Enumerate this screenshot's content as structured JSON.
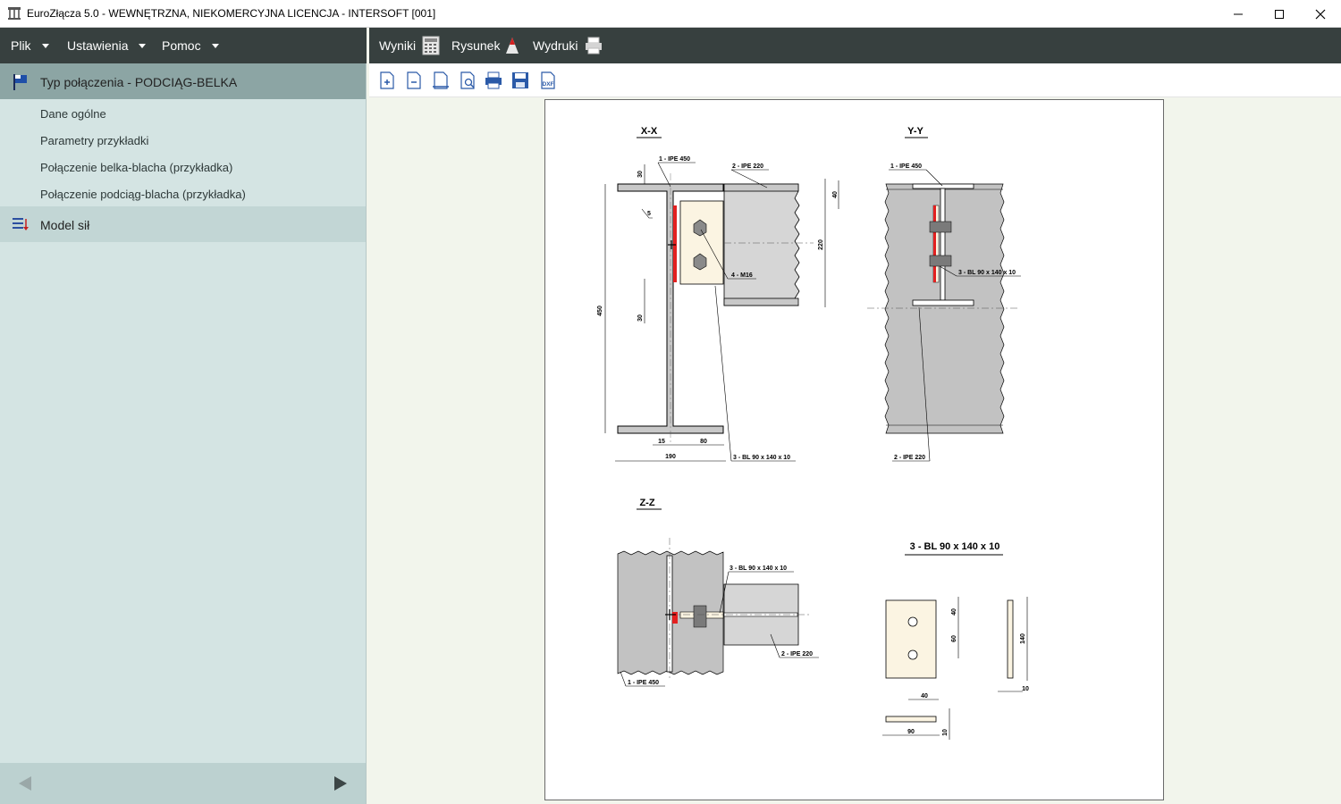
{
  "window": {
    "title": "EuroZłącza 5.0 - WEWNĘTRZNA, NIEKOMERCYJNA LICENCJA - INTERSOFT [001]"
  },
  "left_menu": [
    {
      "label": "Plik"
    },
    {
      "label": "Ustawienia"
    },
    {
      "label": "Pomoc"
    }
  ],
  "sidebar": {
    "group1": {
      "label": "Typ połączenia - PODCIĄG-BELKA"
    },
    "items": [
      {
        "label": "Dane ogólne"
      },
      {
        "label": "Parametry przykładki"
      },
      {
        "label": "Połączenie belka-blacha (przykładka)"
      },
      {
        "label": "Połączenie podciąg-blacha (przykładka)"
      }
    ],
    "group2": {
      "label": "Model sił"
    }
  },
  "top_menu": [
    {
      "label": "Wyniki",
      "icon": "calculator-icon"
    },
    {
      "label": "Rysunek",
      "icon": "drawing-icon"
    },
    {
      "label": "Wydruki",
      "icon": "printer-icon"
    }
  ],
  "toolbar": {
    "buttons": [
      "zoom-in-page",
      "zoom-out-page",
      "fit-width",
      "print-preview",
      "print",
      "save",
      "export-dxf"
    ],
    "dxf_label": "DXF"
  },
  "drawing": {
    "sections": {
      "xx": "X-X",
      "yy": "Y-Y",
      "zz": "Z-Z",
      "plate": "3 - BL 90 x 140 x 10"
    },
    "labels": {
      "ipe450": "1 - IPE 450",
      "ipe220": "2 - IPE 220",
      "plate": "3 - BL 90 x 140 x 10",
      "bolts": "4 - M16"
    },
    "dims": {
      "d30a": "30",
      "d5": "5",
      "d30b": "30",
      "d450": "450",
      "d40": "40",
      "d220": "220",
      "d15": "15",
      "d80": "80",
      "d190": "190",
      "p40a": "40",
      "p60": "60",
      "p140": "140",
      "p10a": "10",
      "p40b": "40",
      "p90": "90",
      "p10b": "10"
    }
  },
  "colors": {
    "menu_bg": "#37403f",
    "sidebar_bg": "#d4e4e3",
    "sidebar_active": "#8ca5a4",
    "steel_fill": "#c8c8c8",
    "plate_fill": "#fbf4e2",
    "weld_red": "#e32020"
  }
}
